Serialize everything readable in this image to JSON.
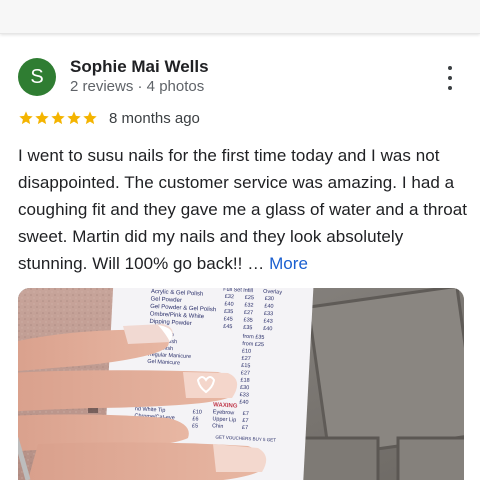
{
  "reviewer": {
    "initial": "S",
    "name": "Sophie Mai Wells",
    "stats": "2 reviews · 4 photos",
    "avatar_color": "#2f7d32"
  },
  "rating": {
    "stars": 5,
    "star_color": "#f4b400",
    "time": "8 months ago"
  },
  "review": {
    "text": "I went to susu nails for the first time today and I was not disappointed. The customer service was amazing. I had a coughing fit and they gave me a glass of water and a throat sweet. Martin did my nails and they look absolutely stunning. Will 100% go back!! …",
    "more_label": "More",
    "link_color": "#1a5fd0"
  },
  "photo": {
    "menu_rows": [
      "Acrylic & Gel Polish",
      "Gel Powder",
      "Gel Powder & Gel Polish",
      "Ombre/Pink & White",
      "Dipping Powder"
    ],
    "col_headers": [
      "Full Set",
      "Infill",
      "Overlay"
    ],
    "prices": [
      [
        "£32",
        "£25",
        "£30"
      ],
      [
        "£40",
        "£32",
        "£40"
      ],
      [
        "£35",
        "£27",
        "£33"
      ],
      [
        "£45",
        "£35",
        "£43"
      ],
      [
        "£45",
        "£35",
        "£40"
      ]
    ],
    "side_prices": [
      "from £35",
      "from £25",
      "£10",
      "£27",
      "£15",
      "£27",
      "£18",
      "£30",
      "£33",
      "£40"
    ],
    "lower_rows": [
      "Gel Polish",
      "Nails Polish",
      "Gel Polish",
      "Regular Manicure",
      "Gel Manicure"
    ],
    "waxing_title": "WAXING",
    "waxing_rows": [
      [
        "Eyebrow",
        "£7"
      ],
      [
        "Upper Lip",
        "£7"
      ],
      [
        "Chin",
        "£7"
      ]
    ],
    "nail_rows": [
      [
        "nd White Tip",
        "£10"
      ],
      [
        "Chrome/Cat-eye",
        "£6"
      ],
      [
        "3D Nail Art (each)",
        "£5"
      ]
    ],
    "voucher_text": "GET VOUCHERS BUY 5 GET"
  }
}
